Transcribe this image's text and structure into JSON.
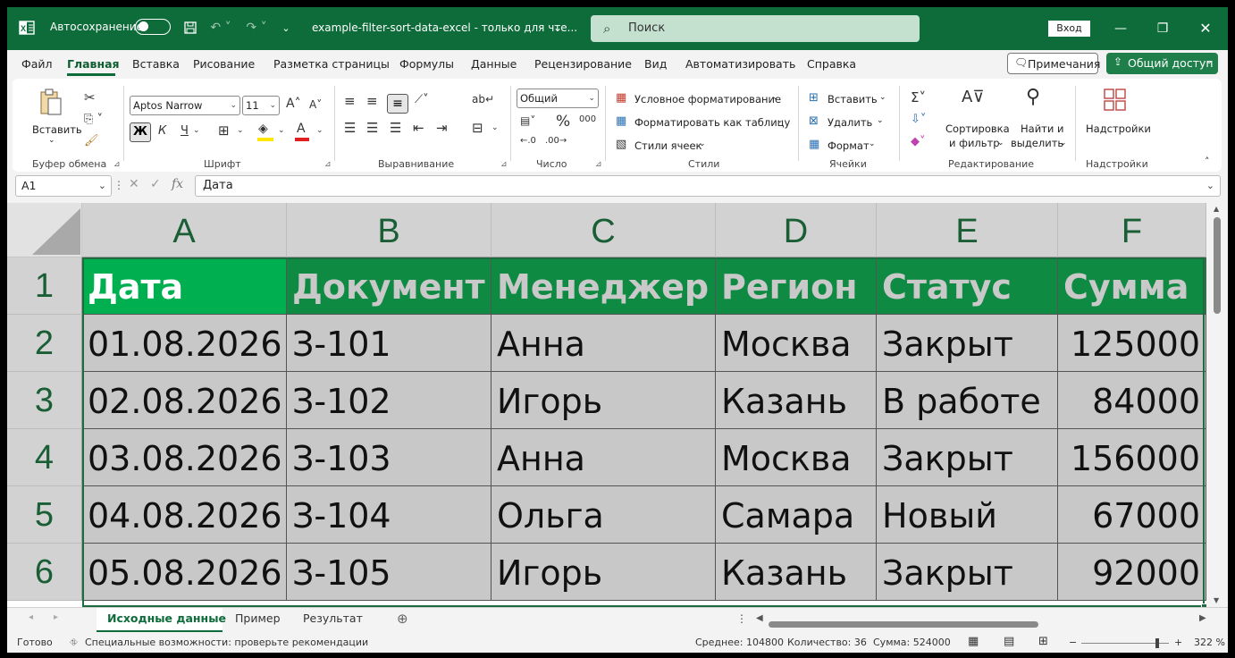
{
  "titlebar": {
    "autosave_label": "Автосохранение",
    "doc_title": "example-filter-sort-data-excel  -  только для чте...",
    "search_placeholder": "Поиск",
    "login_label": "Вход"
  },
  "menu": {
    "items": [
      "Файл",
      "Главная",
      "Вставка",
      "Рисование",
      "Разметка страницы",
      "Формулы",
      "Данные",
      "Рецензирование",
      "Вид",
      "Автоматизировать",
      "Справка"
    ],
    "active": "Главная",
    "notes_label": "Примечания",
    "share_label": "Общий доступ"
  },
  "ribbon": {
    "clipboard": {
      "paste_label": "Вставить",
      "group_label": "Буфер обмена"
    },
    "font": {
      "font_name": "Aptos Narrow",
      "font_size": "11",
      "group_label": "Шрифт",
      "bold": "Ж",
      "italic": "К",
      "underline": "Ч"
    },
    "alignment": {
      "group_label": "Выравнивание"
    },
    "number": {
      "format": "Общий",
      "group_label": "Число",
      "percent": "%",
      "thousands": "000"
    },
    "styles": {
      "conditional": "Условное форматирование",
      "as_table": "Форматировать как таблицу",
      "cell_styles": "Стили ячеек",
      "group_label": "Стили"
    },
    "cells": {
      "insert": "Вставить",
      "delete": "Удалить",
      "format": "Формат",
      "group_label": "Ячейки"
    },
    "editing": {
      "sort_line1": "Сортировка",
      "sort_line2": "и фильтр",
      "find_line1": "Найти и",
      "find_line2": "выделить",
      "group_label": "Редактирование"
    },
    "addins": {
      "label": "Надстройки",
      "group_label": "Надстройки"
    }
  },
  "formula_bar": {
    "name_box": "A1",
    "formula": "Дата"
  },
  "sheet": {
    "columns": [
      "A",
      "B",
      "C",
      "D",
      "E",
      "F"
    ],
    "rows": [
      "1",
      "2",
      "3",
      "4",
      "5",
      "6"
    ],
    "header": [
      "Дата",
      "Документ",
      "Менеджер",
      "Регион",
      "Статус",
      "Сумма"
    ],
    "data": [
      [
        "01.08.2026",
        "З-101",
        "Анна",
        "Москва",
        "Закрыт",
        "125000"
      ],
      [
        "02.08.2026",
        "З-102",
        "Игорь",
        "Казань",
        "В работе",
        "84000"
      ],
      [
        "03.08.2026",
        "З-103",
        "Анна",
        "Москва",
        "Закрыт",
        "156000"
      ],
      [
        "04.08.2026",
        "З-104",
        "Ольга",
        "Самара",
        "Новый",
        "67000"
      ],
      [
        "05.08.2026",
        "З-105",
        "Игорь",
        "Казань",
        "Закрыт",
        "92000"
      ]
    ]
  },
  "sheet_tabs": {
    "tabs": [
      "Исходные данные",
      "Пример",
      "Результат"
    ],
    "active": "Исходные данные"
  },
  "status": {
    "ready": "Готово",
    "accessibility": "Специальные возможности: проверьте рекомендации",
    "average": "Среднее: 104800",
    "count": "Количество: 36",
    "sum": "Сумма: 524000",
    "zoom": "322 %"
  },
  "colors": {
    "title_bar": "#0e6b3a",
    "header_fill": "#0f8a42",
    "header_fill_active": "#00b050",
    "cell_fill": "#c8c8c8"
  }
}
